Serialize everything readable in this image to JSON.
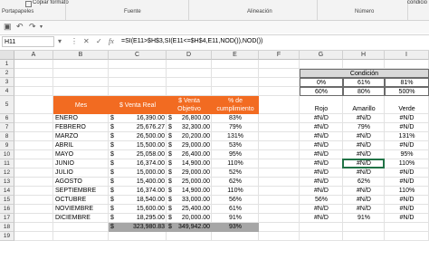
{
  "ribbon": {
    "clipboard_item": "Copiar formato",
    "groups": [
      "Portapapeles",
      "Fuente",
      "Alineación",
      "Número"
    ],
    "right_label": "condicio"
  },
  "formula_bar": {
    "name_box": "H11",
    "formula": "=SI(E11>$H$3,SI(E11<=$H$4,E11,NOD()),NOD())"
  },
  "columns": [
    "A",
    "B",
    "C",
    "D",
    "E",
    "F",
    "G",
    "H",
    "I"
  ],
  "rows": [
    "1",
    "2",
    "3",
    "4",
    "5",
    "6",
    "7",
    "8",
    "9",
    "10",
    "11",
    "12",
    "13",
    "14",
    "15",
    "16",
    "17",
    "18",
    "19"
  ],
  "condition_table": {
    "title": "Condición",
    "row1": [
      "0%",
      "61%",
      "81%"
    ],
    "row2": [
      "60%",
      "80%",
      "500%"
    ]
  },
  "headers": {
    "mes": "Mes",
    "venta_real": "$ Venta Real",
    "venta_obj_1": "$ Venta",
    "venta_obj_2": "Objetivo",
    "pct_1": "% de",
    "pct_2": "cumplimiento",
    "rojo": "Rojo",
    "amarillo": "Amarillo",
    "verde": "Verde"
  },
  "currency_symbol": "$",
  "data_rows": [
    {
      "mes": "ENERO",
      "real": "16,390.00",
      "obj": "26,800.00",
      "pct": "83%",
      "g": "#N/D",
      "h": "#N/D",
      "i": "#N/D"
    },
    {
      "mes": "FEBRERO",
      "real": "25,676.27",
      "obj": "32,300.00",
      "pct": "79%",
      "g": "#N/D",
      "h": "79%",
      "i": "#N/D"
    },
    {
      "mes": "MARZO",
      "real": "26,500.00",
      "obj": "20,200.00",
      "pct": "131%",
      "g": "#N/D",
      "h": "#N/D",
      "i": "131%"
    },
    {
      "mes": "ABRIL",
      "real": "15,500.00",
      "obj": "29,000.00",
      "pct": "53%",
      "g": "#N/D",
      "h": "#N/D",
      "i": "#N/D"
    },
    {
      "mes": "MAYO",
      "real": "25,058.00",
      "obj": "26,400.00",
      "pct": "95%",
      "g": "#N/D",
      "h": "#N/D",
      "i": "95%"
    },
    {
      "mes": "JUNIO",
      "real": "16,374.00",
      "obj": "14,900.00",
      "pct": "110%",
      "g": "#N/D",
      "h": "#N/D",
      "i": "110%"
    },
    {
      "mes": "JULIO",
      "real": "15,000.00",
      "obj": "29,000.00",
      "pct": "52%",
      "g": "#N/D",
      "h": "#N/D",
      "i": "#N/D"
    },
    {
      "mes": "AGOSTO",
      "real": "15,400.00",
      "obj": "25,000.00",
      "pct": "62%",
      "g": "#N/D",
      "h": "62%",
      "i": "#N/D"
    },
    {
      "mes": "SEPTIEMBRE",
      "real": "16,374.00",
      "obj": "14,900.00",
      "pct": "110%",
      "g": "#N/D",
      "h": "#N/D",
      "i": "110%"
    },
    {
      "mes": "OCTUBRE",
      "real": "18,540.00",
      "obj": "33,000.00",
      "pct": "56%",
      "g": "56%",
      "h": "#N/D",
      "i": "#N/D"
    },
    {
      "mes": "NOVIEMBRE",
      "real": "15,600.00",
      "obj": "25,400.00",
      "pct": "61%",
      "g": "#N/D",
      "h": "#N/D",
      "i": "#N/D"
    },
    {
      "mes": "DICIEMBRE",
      "real": "18,295.00",
      "obj": "20,000.00",
      "pct": "91%",
      "g": "#N/D",
      "h": "91%",
      "i": "#N/D"
    }
  ],
  "total_row": {
    "real": "323,980.83",
    "obj": "349,942.00",
    "pct": "93%"
  }
}
